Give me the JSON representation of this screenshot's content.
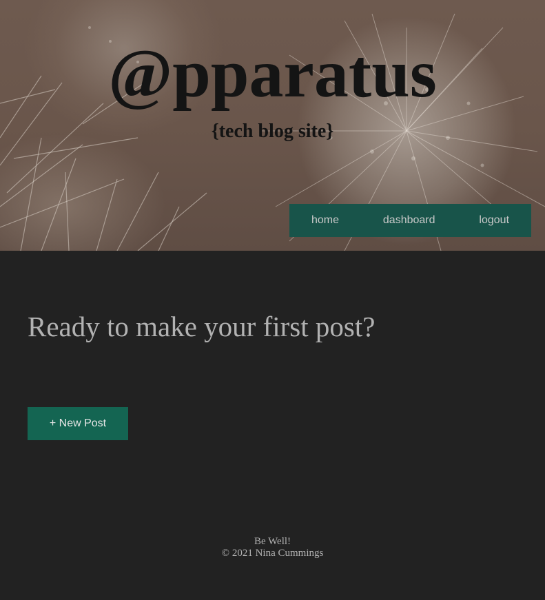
{
  "header": {
    "title": "@pparatus",
    "subtitle": "{tech blog site}",
    "background_image": "cactus-photo"
  },
  "nav": {
    "items": [
      {
        "label": "home"
      },
      {
        "label": "dashboard"
      },
      {
        "label": "logout"
      }
    ],
    "background_color": "#18544a"
  },
  "main": {
    "heading": "Ready to make your first post?",
    "new_post_label": "+ New Post",
    "button_color": "#146552"
  },
  "footer": {
    "line1": "Be Well!",
    "line2": "© 2021 Nina Cummings"
  },
  "colors": {
    "page_background": "#222222",
    "text_muted": "#b2b2b2"
  }
}
